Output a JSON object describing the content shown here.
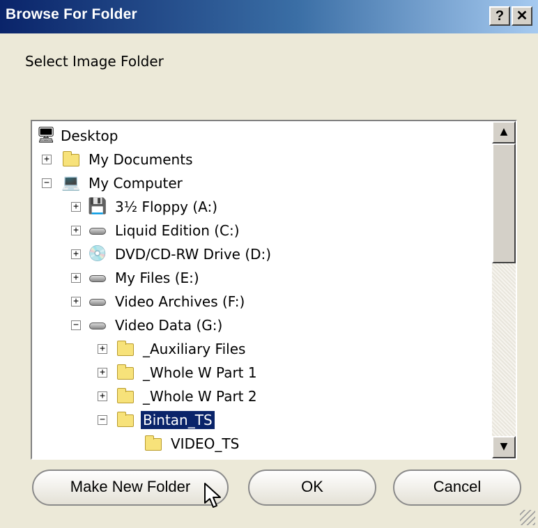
{
  "window": {
    "title": "Browse For Folder",
    "help_label": "?",
    "close_label": "✕"
  },
  "prompt": "Select Image Folder",
  "tree": {
    "items": [
      {
        "label": "Desktop",
        "icon": "desktop-icon",
        "expander": ""
      },
      {
        "label": "My Documents",
        "icon": "my-documents-icon",
        "expander": "+"
      },
      {
        "label": "My Computer",
        "icon": "my-computer-icon",
        "expander": "−"
      },
      {
        "label": "3½ Floppy (A:)",
        "icon": "floppy-drive-icon",
        "expander": "+"
      },
      {
        "label": "Liquid Edition (C:)",
        "icon": "hard-drive-icon",
        "expander": "+"
      },
      {
        "label": "DVD/CD-RW Drive (D:)",
        "icon": "dvd-drive-icon",
        "expander": "+"
      },
      {
        "label": "My Files (E:)",
        "icon": "hard-drive-icon",
        "expander": "+"
      },
      {
        "label": "Video Archives (F:)",
        "icon": "hard-drive-icon",
        "expander": "+"
      },
      {
        "label": "Video Data (G:)",
        "icon": "hard-drive-icon",
        "expander": "−"
      },
      {
        "label": "_Auxiliary Files",
        "icon": "folder-icon",
        "expander": "+"
      },
      {
        "label": "_Whole W Part 1",
        "icon": "folder-icon",
        "expander": "+"
      },
      {
        "label": "_Whole W Part 2",
        "icon": "folder-icon",
        "expander": "+"
      },
      {
        "label": "Bintan_TS",
        "icon": "folder-open-icon",
        "expander": "−",
        "selected": true
      },
      {
        "label": "VIDEO_TS",
        "icon": "folder-icon",
        "expander": ""
      }
    ]
  },
  "buttons": {
    "make_new_folder": "Make New Folder",
    "ok": "OK",
    "cancel": "Cancel"
  },
  "colors": {
    "titlebar": "#0a246a",
    "selection": "#0a246a",
    "dialog_bg": "#ece9d8"
  }
}
